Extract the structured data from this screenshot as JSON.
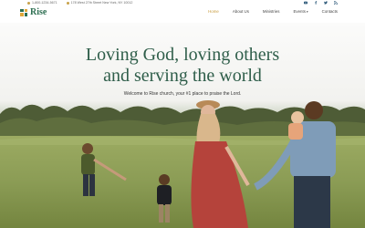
{
  "header": {
    "logo_text": "Rise",
    "phone": "1-800-1234-5671",
    "address": "178 West 27th Street New York, NY 10012",
    "social_icons": [
      "youtube-icon",
      "facebook-icon",
      "twitter-icon",
      "rss-icon"
    ],
    "nav": [
      {
        "label": "Home",
        "active": true
      },
      {
        "label": "About Us",
        "active": false
      },
      {
        "label": "Ministries",
        "active": false
      },
      {
        "label": "Events",
        "active": false,
        "dropdown": true
      },
      {
        "label": "Contacts",
        "active": false
      }
    ]
  },
  "hero": {
    "title_line1": "Loving God, loving others",
    "title_line2": "and serving the world",
    "subtitle": "Welcome to Rise church, your #1 place to praise the Lord."
  },
  "colors": {
    "brand_green": "#2e6f52",
    "accent_gold": "#c79a3a"
  }
}
